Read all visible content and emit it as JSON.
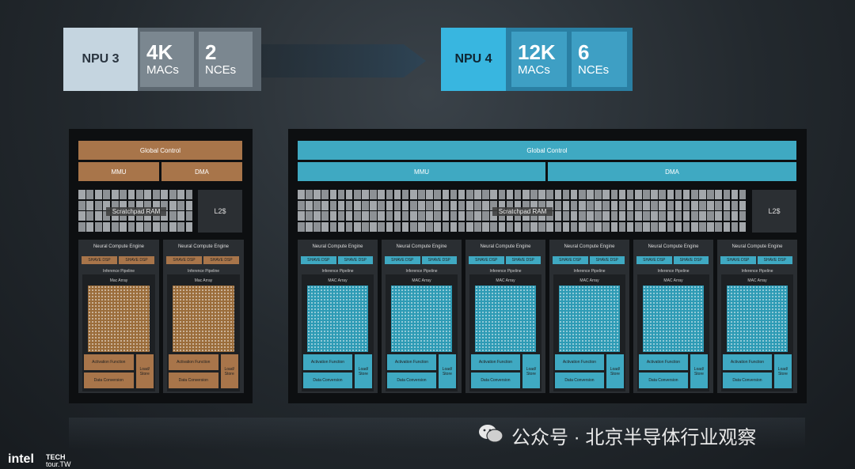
{
  "header": {
    "left": {
      "name": "NPU 3",
      "macs_value": "4K",
      "macs_label": "MACs",
      "nces_value": "2",
      "nces_label": "NCEs"
    },
    "right": {
      "name": "NPU 4",
      "macs_value": "12K",
      "macs_label": "MACs",
      "nces_value": "6",
      "nces_label": "NCEs"
    }
  },
  "labels": {
    "global_control": "Global Control",
    "mmu": "MMU",
    "dma": "DMA",
    "scratchpad": "Scratchpad RAM",
    "l2": "L2$",
    "nce": "Neural Compute Engine",
    "shave": "SHAVE DSP",
    "inference": "Inference Pipeline",
    "mac_array": "Mac Array",
    "mac_array_right": "MAC Array",
    "activation": "Activation Function",
    "load_store": "Load/ Store",
    "data_conversion": "Data Conversion"
  },
  "colors": {
    "npu3_accent": "#a8754a",
    "npu4_accent": "#3fa9c2"
  },
  "footer": {
    "watermark": "公众号 · 北京半导体行业观察",
    "brand": "intel",
    "event_line1": "TECH",
    "event_line2": "tour.TW"
  }
}
